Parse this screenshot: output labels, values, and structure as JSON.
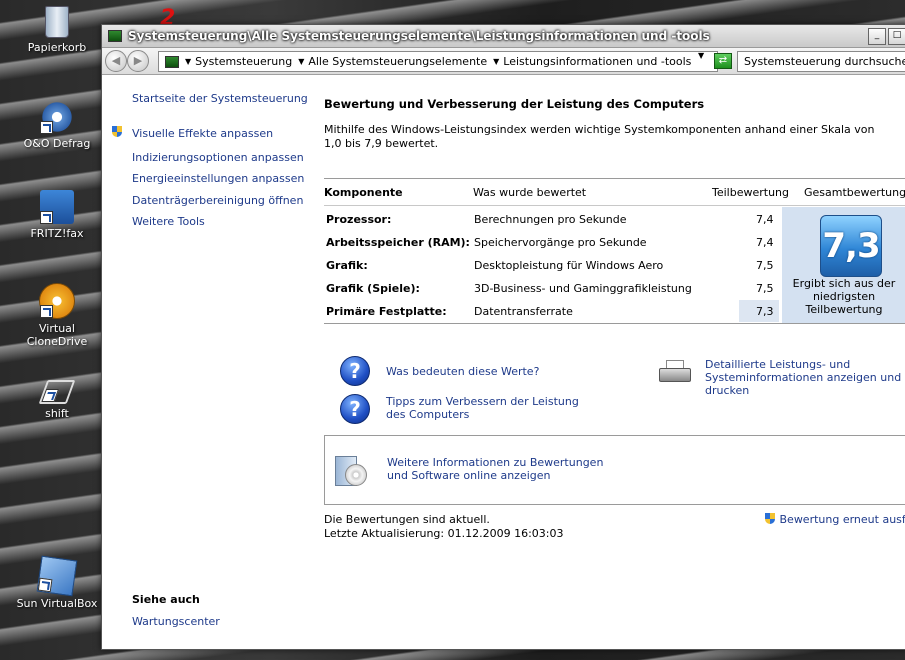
{
  "desktop": {
    "icons": [
      {
        "label": "Papierkorb"
      },
      {
        "label": "O&O Defrag"
      },
      {
        "label": "FRITZ!fax"
      },
      {
        "label": "Virtual CloneDrive"
      },
      {
        "label": "shift"
      },
      {
        "label": "Sun VirtualBox"
      }
    ]
  },
  "window": {
    "title": "Systemsteuerung\\Alle Systemsteuerungselemente\\Leistungsinformationen und -tools",
    "minimize_glyph": "_",
    "maximize_glyph": "□"
  },
  "address": {
    "crumbs": [
      "Systemsteuerung",
      "Alle Systemsteuerungselemente",
      "Leistungsinformationen und -tools"
    ],
    "search_placeholder": "Systemsteuerung durchsuchen"
  },
  "leftnav": {
    "home": "Startseite der Systemsteuerung",
    "tasks": [
      "Visuelle Effekte anpassen",
      "Indizierungsoptionen anpassen",
      "Energieeinstellungen anpassen",
      "Datenträgerbereinigung öffnen",
      "Weitere Tools"
    ],
    "see_also_heading": "Siehe auch",
    "see_also": [
      "Wartungscenter"
    ]
  },
  "main": {
    "heading": "Bewertung und Verbesserung der Leistung des Computers",
    "description": "Mithilfe des Windows-Leistungsindex werden wichtige Systemkomponenten anhand einer Skala von 1,0 bis 7,9 bewertet.",
    "table": {
      "headers": [
        "Komponente",
        "Was wurde bewertet",
        "Teilbewertung",
        "Gesamtbewertung"
      ],
      "rows": [
        {
          "component": "Prozessor:",
          "rated": "Berechnungen pro Sekunde",
          "score": "7,4"
        },
        {
          "component": "Arbeitsspeicher (RAM):",
          "rated": "Speichervorgänge pro Sekunde",
          "score": "7,4"
        },
        {
          "component": "Grafik:",
          "rated": "Desktopleistung für Windows Aero",
          "score": "7,5"
        },
        {
          "component": "Grafik (Spiele):",
          "rated": "3D-Business- und Gaminggrafikleistung",
          "score": "7,5"
        },
        {
          "component": "Primäre Festplatte:",
          "rated": "Datentransferrate",
          "score": "7,3"
        }
      ],
      "base_score": "7,3",
      "base_caption": "Ergibt sich aus der niedrigsten Teilbewertung"
    },
    "links": {
      "what_mean": "Was bedeuten diese Werte?",
      "tips": "Tipps zum Verbessern der Leistung des Computers",
      "details": "Detaillierte Leistungs- und Systeminformationen anzeigen und drucken",
      "online": "Weitere Informationen zu Bewertungen und Software online anzeigen"
    },
    "status_line1": "Die Bewertungen sind aktuell.",
    "status_line2": "Letzte Aktualisierung: 01.12.2009 16:03:03",
    "rerun": "Bewertung erneut ausführen"
  },
  "colors": {
    "link": "#1e3a8a",
    "score_panel": "#d4e1f1"
  }
}
